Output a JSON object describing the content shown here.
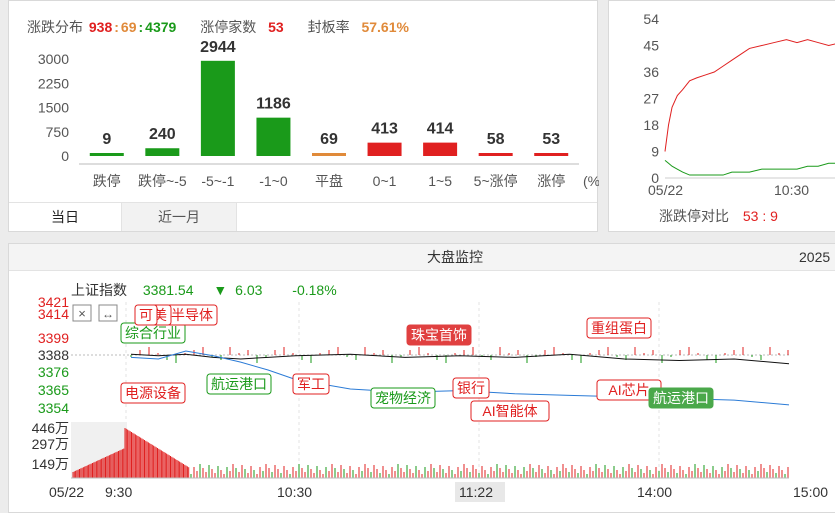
{
  "distribution": {
    "header": {
      "label": "涨跌分布",
      "up": "938",
      "sep1": ":",
      "flat": "69",
      "sep2": ":",
      "down": "4379",
      "limit_up_label": "涨停家数",
      "limit_up_count": "53",
      "seal_rate_label": "封板率",
      "seal_rate": "57.61%"
    },
    "unit_label": "(%)",
    "tabs": [
      "当日",
      "近一月"
    ],
    "active_tab": 0
  },
  "ratio_panel": {
    "label": "涨跌停对比",
    "value": "53 : 9"
  },
  "monitor": {
    "title": "大盘监控",
    "year_fragment": "2025",
    "index_name": "上证指数",
    "index_value": "3381.54",
    "change_arrow": "▼",
    "change": "6.03",
    "change_pct": "-0.18%",
    "price_labels": [
      "3421",
      "3414",
      "3399",
      "3388",
      "3376",
      "3365",
      "3354"
    ],
    "volume_labels": [
      "446万",
      "297万",
      "149万"
    ],
    "time_labels": [
      "05/22",
      "9:30",
      "10:30",
      "11:22",
      "14:00",
      "15:00"
    ],
    "events": [
      {
        "text": "综合行业",
        "kind": "green-outline"
      },
      {
        "text": "半导体",
        "kind": "red-outline"
      },
      {
        "text": "美",
        "kind": "red-outline"
      },
      {
        "text": "可",
        "kind": "red-outline"
      },
      {
        "text": "电源设备",
        "kind": "red-outline"
      },
      {
        "text": "航运港口",
        "kind": "green-outline"
      },
      {
        "text": "军工",
        "kind": "red-outline"
      },
      {
        "text": "宠物经济",
        "kind": "green-outline"
      },
      {
        "text": "珠宝首饰",
        "kind": "red-fill"
      },
      {
        "text": "银行",
        "kind": "red-outline"
      },
      {
        "text": "AI智能体",
        "kind": "red-outline"
      },
      {
        "text": "重组蛋白",
        "kind": "red-outline"
      },
      {
        "text": "AI芯片",
        "kind": "red-outline"
      },
      {
        "text": "航运港口",
        "kind": "green-fill"
      }
    ],
    "icons": [
      "close-icon",
      "expand-horizontal-icon"
    ]
  },
  "chart_data": [
    {
      "type": "bar",
      "title": "",
      "categories": [
        "跌停",
        "跌停~-5",
        "-5~-1",
        "-1~0",
        "平盘",
        "0~1",
        "1~5",
        "5~涨停",
        "涨停"
      ],
      "values": [
        9,
        240,
        2944,
        1186,
        69,
        413,
        414,
        58,
        53
      ],
      "colors": [
        "#1a9a1a",
        "#1a9a1a",
        "#1a9a1a",
        "#1a9a1a",
        "#e08a3a",
        "#e02020",
        "#e02020",
        "#e02020",
        "#e02020"
      ],
      "ylim": [
        0,
        3000
      ],
      "yticks": [
        0,
        750,
        1500,
        2250,
        3000
      ],
      "xlabel": "(%)",
      "ylabel": ""
    },
    {
      "type": "line",
      "title": "涨跌停对比",
      "x_ticks": [
        "05/22",
        "10:30"
      ],
      "yticks": [
        0,
        9,
        18,
        27,
        36,
        45,
        54
      ],
      "ylim": [
        0,
        54
      ],
      "series": [
        {
          "name": "涨停",
          "color": "#e02020",
          "x": [
            0,
            4,
            8,
            14,
            20,
            28,
            36,
            46,
            56,
            66,
            76,
            86,
            96,
            110,
            124,
            138,
            150,
            162,
            174,
            186,
            200
          ],
          "values": [
            9,
            18,
            24,
            28,
            30,
            33,
            34,
            35,
            36,
            38,
            40,
            42,
            44,
            45,
            46,
            47,
            46,
            47,
            46,
            45,
            46
          ]
        },
        {
          "name": "跌停",
          "color": "#1a9a1a",
          "x": [
            0,
            4,
            8,
            14,
            20,
            28,
            36,
            46,
            56,
            66,
            76,
            86,
            96,
            110,
            124,
            138,
            150,
            162,
            174,
            186,
            200
          ],
          "values": [
            6,
            5,
            4,
            3,
            2,
            1,
            1,
            1,
            1,
            1,
            2,
            2,
            2,
            3,
            3,
            3,
            3,
            4,
            4,
            5,
            5
          ]
        }
      ]
    },
    {
      "type": "line",
      "title": "上证指数",
      "x_ticks": [
        "9:30",
        "10:30",
        "11:22",
        "14:00",
        "15:00"
      ],
      "ylim": [
        3354,
        3421
      ],
      "yticks": [
        3354,
        3365,
        3376,
        3388,
        3399,
        3414,
        3421
      ],
      "series": [
        {
          "name": "上证指数",
          "color": "#111111",
          "x": [
            0,
            10,
            20,
            30,
            40,
            50,
            60,
            80,
            100,
            120,
            140,
            160,
            180,
            200,
            220,
            240
          ],
          "values": [
            3388,
            3387,
            3388,
            3386,
            3385,
            3386,
            3387,
            3388,
            3386,
            3387,
            3386,
            3388,
            3385,
            3384,
            3385,
            3382
          ]
        },
        {
          "name": "",
          "color": "#2b7bd6",
          "x": [
            0,
            10,
            20,
            30,
            40,
            50,
            60,
            80,
            100,
            120,
            140,
            160,
            180,
            200,
            220,
            240
          ],
          "values": [
            3386,
            3385,
            3390,
            3387,
            3383,
            3378,
            3372,
            3366,
            3364,
            3365,
            3363,
            3362,
            3361,
            3360,
            3359,
            3356
          ]
        }
      ]
    }
  ]
}
